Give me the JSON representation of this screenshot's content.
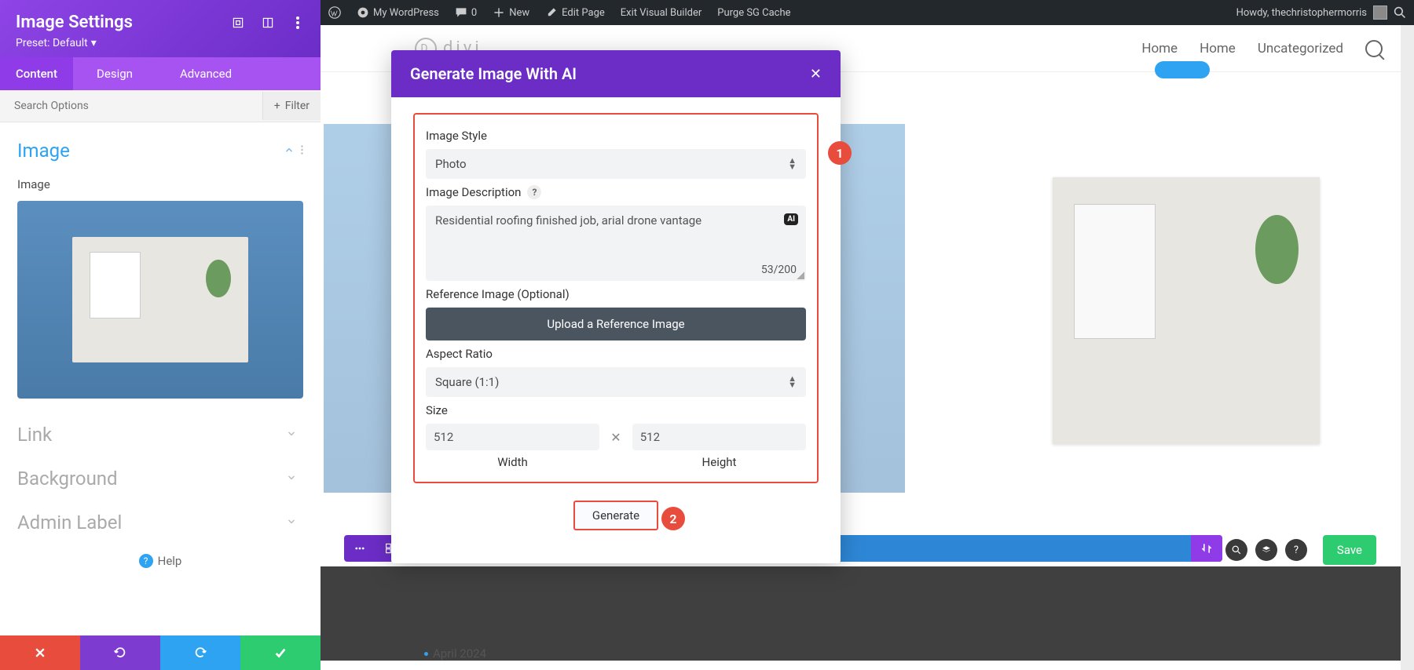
{
  "adminbar": {
    "site": "My WordPress",
    "comments": "0",
    "new": "New",
    "edit": "Edit Page",
    "exit_vb": "Exit Visual Builder",
    "purge": "Purge SG Cache",
    "howdy": "Howdy, thechristophermorris"
  },
  "panel": {
    "title": "Image Settings",
    "preset": "Preset: Default",
    "tabs": {
      "content": "Content",
      "design": "Design",
      "advanced": "Advanced"
    },
    "search_placeholder": "Search Options",
    "filter": "Filter",
    "groups": {
      "image": "Image",
      "image_label": "Image",
      "link": "Link",
      "background": "Background",
      "admin_label": "Admin Label"
    },
    "help": "Help"
  },
  "header": {
    "logo": "divi",
    "nav": {
      "home1": "Home",
      "home2": "Home",
      "uncat": "Uncategorized"
    }
  },
  "toolbar": {
    "save": "Save"
  },
  "modal": {
    "title": "Generate Image With AI",
    "style_label": "Image Style",
    "style_value": "Photo",
    "desc_label": "Image Description",
    "desc_value": "Residential roofing finished job, arial drone vantage",
    "counter": "53/200",
    "ref_label": "Reference Image (Optional)",
    "upload": "Upload a Reference Image",
    "ratio_label": "Aspect Ratio",
    "ratio_value": "Square (1:1)",
    "size_label": "Size",
    "width": "512",
    "height": "512",
    "width_l": "Width",
    "height_l": "Height",
    "generate": "Generate",
    "badge1": "1",
    "badge2": "2",
    "ai": "AI"
  },
  "archive": "April 2024"
}
